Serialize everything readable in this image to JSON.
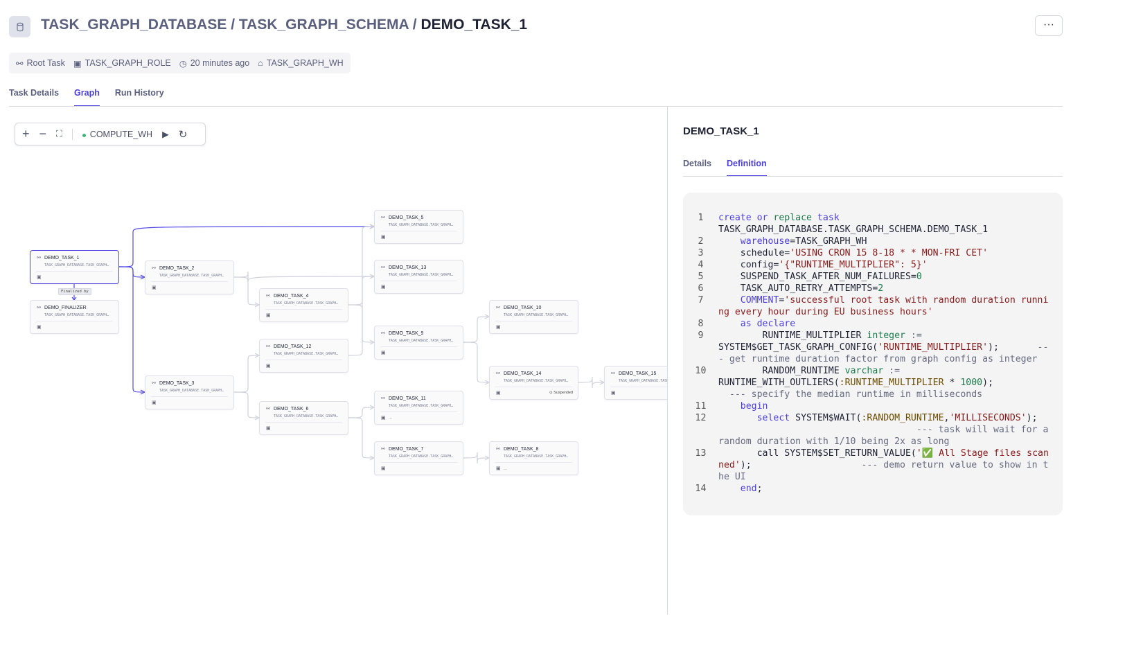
{
  "header": {
    "icon": "database-icon",
    "breadcrumb": [
      "TASK_GRAPH_DATABASE",
      "TASK_GRAPH_SCHEMA"
    ],
    "separator": "/",
    "current": "DEMO_TASK_1",
    "more_label": "···"
  },
  "meta": {
    "type": "Root Task",
    "role": "TASK_GRAPH_ROLE",
    "updated": "20 minutes ago",
    "warehouse": "TASK_GRAPH_WH"
  },
  "tabs": [
    {
      "label": "Task Details"
    },
    {
      "label": "Graph",
      "active": true
    },
    {
      "label": "Run History"
    }
  ],
  "toolbar": {
    "warehouse": "COMPUTE_WH",
    "status_color": "#3cb878"
  },
  "graph": {
    "accent": "#5148e6",
    "finalized_label": "Finalized by",
    "nodes": [
      {
        "name": "DEMO_TASK_1",
        "fq": "TASK_GRAPH_DATABASE.TASK_GRAPH…",
        "selected": true
      },
      {
        "name": "DEMO_FINALIZER",
        "fq": "TASK_GRAPH_DATABASE.TASK_GRAPH…"
      },
      {
        "name": "DEMO_TASK_2",
        "fq": "TASK_GRAPH_DATABASE.TASK_GRAPH…"
      },
      {
        "name": "DEMO_TASK_3",
        "fq": "TASK_GRAPH_DATABASE.TASK_GRAPH…"
      },
      {
        "name": "DEMO_TASK_4",
        "fq": "TASK_GRAPH_DATABASE.TASK_GRAPH…"
      },
      {
        "name": "DEMO_TASK_12",
        "fq": "TASK_GRAPH_DATABASE.TASK_GRAPH…"
      },
      {
        "name": "DEMO_TASK_6",
        "fq": "TASK_GRAPH_DATABASE.TASK_GRAPH…"
      },
      {
        "name": "DEMO_TASK_5",
        "fq": "TASK_GRAPH_DATABASE.TASK_GRAPH…"
      },
      {
        "name": "DEMO_TASK_13",
        "fq": "TASK_GRAPH_DATABASE.TASK_GRAPH…"
      },
      {
        "name": "DEMO_TASK_9",
        "fq": "TASK_GRAPH_DATABASE.TASK_GRAPH…"
      },
      {
        "name": "DEMO_TASK_11",
        "fq": "TASK_GRAPH_DATABASE.TASK_GRAPH…",
        "extra": "…"
      },
      {
        "name": "DEMO_TASK_7",
        "fq": "TASK_GRAPH_DATABASE.TASK_GRAPH…"
      },
      {
        "name": "DEMO_TASK_10",
        "fq": "TASK_GRAPH_DATABASE.TASK_GRAPH…"
      },
      {
        "name": "DEMO_TASK_14",
        "fq": "TASK_GRAPH_DATABASE.TASK_GRAPH…",
        "status": "Suspended"
      },
      {
        "name": "DEMO_TASK_8",
        "fq": "TASK_GRAPH_DATABASE.TASK_GRAPH…",
        "extra": "…"
      },
      {
        "name": "DEMO_TASK_15",
        "fq": "TASK_GRAPH_DATABASE.TASK_GRAPH…"
      }
    ],
    "edges": [
      [
        "DEMO_TASK_1",
        "DEMO_TASK_5"
      ],
      [
        "DEMO_TASK_1",
        "DEMO_TASK_2"
      ],
      [
        "DEMO_TASK_1",
        "DEMO_TASK_3"
      ],
      [
        "DEMO_TASK_2",
        "DEMO_TASK_13"
      ],
      [
        "DEMO_TASK_2",
        "DEMO_TASK_4"
      ],
      [
        "DEMO_TASK_4",
        "DEMO_TASK_5"
      ],
      [
        "DEMO_TASK_4",
        "DEMO_TASK_9"
      ],
      [
        "DEMO_TASK_3",
        "DEMO_TASK_12"
      ],
      [
        "DEMO_TASK_3",
        "DEMO_TASK_6"
      ],
      [
        "DEMO_TASK_12",
        "DEMO_TASK_13"
      ],
      [
        "DEMO_TASK_6",
        "DEMO_TASK_11"
      ],
      [
        "DEMO_TASK_6",
        "DEMO_TASK_7"
      ],
      [
        "DEMO_TASK_9",
        "DEMO_TASK_10"
      ],
      [
        "DEMO_TASK_9",
        "DEMO_TASK_14"
      ],
      [
        "DEMO_TASK_14",
        "DEMO_TASK_15"
      ],
      [
        "DEMO_TASK_7",
        "DEMO_TASK_8"
      ]
    ]
  },
  "side": {
    "title": "DEMO_TASK_1",
    "tabs": [
      {
        "label": "Details"
      },
      {
        "label": "Definition",
        "active": true
      }
    ]
  },
  "code": [
    [
      [
        "k",
        "create or "
      ],
      [
        "g",
        "replace "
      ],
      [
        "k",
        "task"
      ],
      [
        "",
        "\nTASK_GRAPH_DATABASE.TASK_GRAPH_SCHEMA.DEMO_TASK_1"
      ]
    ],
    [
      [
        "",
        "    "
      ],
      [
        "k",
        "warehouse"
      ],
      [
        "",
        "=TASK_GRAPH_WH"
      ]
    ],
    [
      [
        "",
        "    schedule="
      ],
      [
        "s",
        "'USING CRON 15 8-18 * * MON-FRI CET'"
      ]
    ],
    [
      [
        "",
        "    config="
      ],
      [
        "s",
        "'{\"RUNTIME_MULTIPLIER\": 5}'"
      ]
    ],
    [
      [
        "",
        "    SUSPEND_TASK_AFTER_NUM_FAILURES="
      ],
      [
        "n",
        "0"
      ]
    ],
    [
      [
        "",
        "    TASK_AUTO_RETRY_ATTEMPTS="
      ],
      [
        "n",
        "2"
      ]
    ],
    [
      [
        "",
        "    "
      ],
      [
        "k",
        "COMMENT"
      ],
      [
        "",
        "="
      ],
      [
        "s",
        "'successful root task with random duration running every hour during EU business hours'"
      ]
    ],
    [
      [
        "",
        "    "
      ],
      [
        "k",
        "as declare"
      ]
    ],
    [
      [
        "",
        "        RUNTIME_MULTIPLIER "
      ],
      [
        "g",
        "integer"
      ],
      [
        "c",
        " :="
      ],
      [
        "",
        "\nSYSTEM$GET_TASK_GRAPH_CONFIG("
      ],
      [
        "s",
        "'RUNTIME_MULTIPLIER'"
      ],
      [
        "",
        ");       "
      ],
      [
        "c",
        "--- get runtime duration factor from graph config as integer"
      ]
    ],
    [
      [
        "",
        "        RANDOM_RUNTIME "
      ],
      [
        "g",
        "varchar"
      ],
      [
        "c",
        " :="
      ],
      [
        "",
        "\nRUNTIME_WITH_OUTLIERS("
      ],
      [
        "v",
        ":RUNTIME_MULTIPLIER"
      ],
      [
        "",
        " * "
      ],
      [
        "n",
        "1000"
      ],
      [
        "",
        ");\n  "
      ],
      [
        "c",
        "--- specify the median runtime in milliseconds"
      ]
    ],
    [
      [
        "",
        "    "
      ],
      [
        "k",
        "begin"
      ]
    ],
    [
      [
        "",
        "       "
      ],
      [
        "k",
        "select"
      ],
      [
        "",
        " SYSTEM$WAIT("
      ],
      [
        "v",
        ":RANDOM_RUNTIME"
      ],
      [
        "",
        ","
      ],
      [
        "s",
        "'MILLISECONDS'"
      ],
      [
        "",
        ");\n                                    "
      ],
      [
        "c",
        "--- task will wait for a random duration with 1/10 being 2x as long"
      ]
    ],
    [
      [
        "",
        "       call SYSTEM$SET_RETURN_VALUE("
      ],
      [
        "s",
        "'✅ All Stage files scanned'"
      ],
      [
        "",
        ");                    "
      ],
      [
        "c",
        "--- demo return value to show in the UI"
      ]
    ],
    [
      [
        "",
        "    "
      ],
      [
        "k",
        "end"
      ],
      [
        "",
        ";"
      ]
    ]
  ]
}
